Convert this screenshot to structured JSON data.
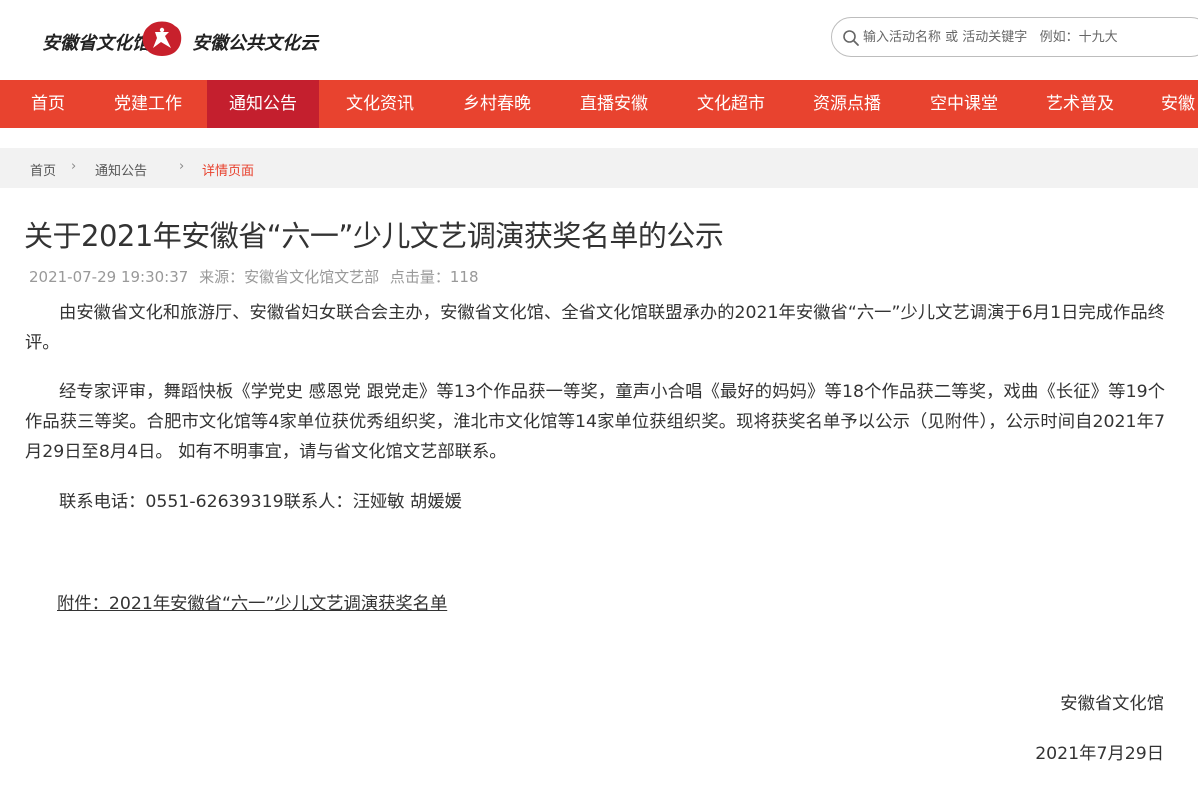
{
  "header": {
    "logo_left": "安徽省文化馆",
    "logo_right": "安徽公共文化云",
    "search": {
      "placeholder": "输入活动名称 或 活动关键字   例如：十九大",
      "value": ""
    }
  },
  "nav": {
    "items": [
      {
        "label": "首页"
      },
      {
        "label": "党建工作"
      },
      {
        "label": "通知公告"
      },
      {
        "label": "文化资讯"
      },
      {
        "label": "乡村春晚"
      },
      {
        "label": "直播安徽"
      },
      {
        "label": "文化超市"
      },
      {
        "label": "资源点播"
      },
      {
        "label": "空中课堂"
      },
      {
        "label": "艺术普及"
      },
      {
        "label": "安徽"
      }
    ],
    "active_index": 2
  },
  "breadcrumb": {
    "items": [
      "首页",
      "通知公告",
      "详情页面"
    ],
    "separator": "›"
  },
  "article": {
    "title": "关于2021年安徽省“六一”少儿文艺调演获奖名单的公示",
    "published": "2021-07-29 19:30:37",
    "source": "来源：安徽省文化馆文艺部",
    "hits": "点击量：118",
    "paragraphs": [
      "由安徽省文化和旅游厅、安徽省妇女联合会主办，安徽省文化馆、全省文化馆联盟承办的2021年安徽省“六一”少儿文艺调演于6月1日完成作品终评。",
      "经专家评审，舞蹈快板《学党史 感恩党 跟党走》等13个作品获一等奖，童声小合唱《最好的妈妈》等18个作品获二等奖，戏曲《长征》等19个作品获三等奖。合肥市文化馆等4家单位获优秀组织奖，淮北市文化馆等14家单位获组织奖。现将获奖名单予以公示（见附件），公示时间自2021年7月29日至8月4日。 如有不明事宜，请与省文化馆文艺部联系。",
      "联系电话：0551-62639319联系人：汪娅敏 胡媛媛"
    ],
    "attachment": "附件：2021年安徽省“六一”少儿文艺调演获奖名单",
    "signature_org": "安徽省文化馆",
    "signature_date": "2021年7月29日"
  },
  "colors": {
    "nav_bg": "#e8432f",
    "nav_active": "#c41f2e",
    "breadcrumb_current": "#e8432f"
  }
}
